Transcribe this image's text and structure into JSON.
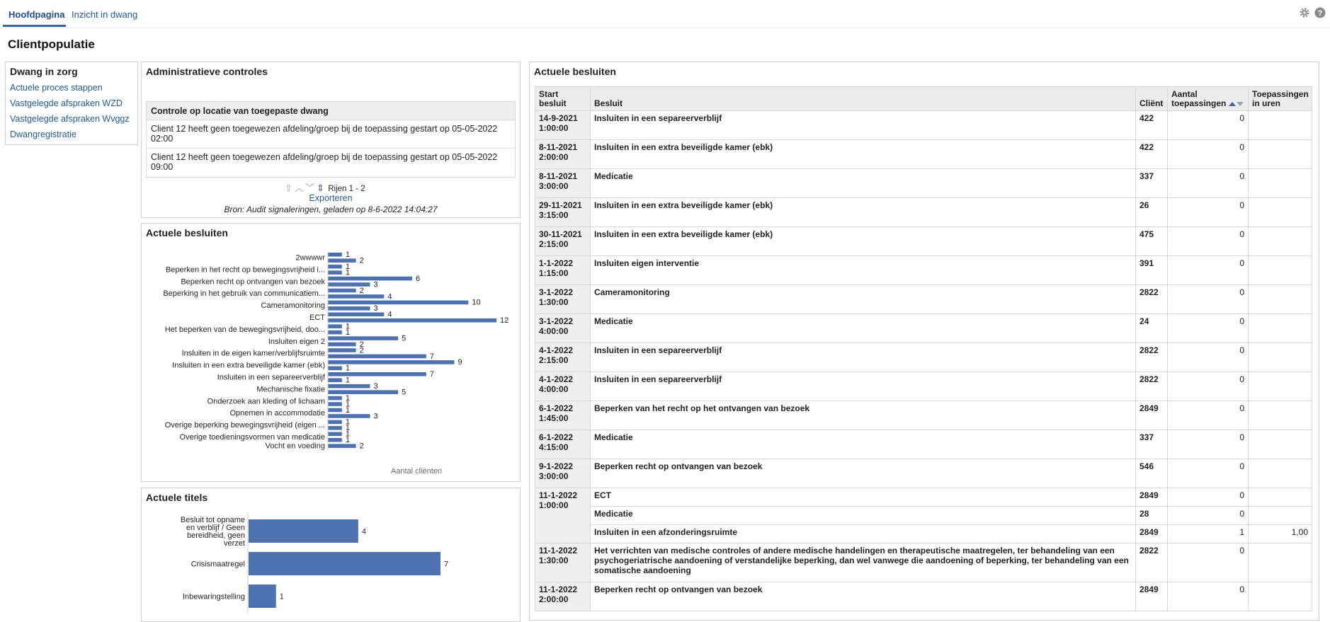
{
  "tabs": [
    {
      "label": "Hoofdpagina",
      "active": true
    },
    {
      "label": "Inzicht in dwang",
      "active": false
    }
  ],
  "top_icons": [
    "gear-icon",
    "help-icon"
  ],
  "page_title": "Clientpopulatie",
  "menu": {
    "title": "Dwang in zorg",
    "links": [
      "Actuele proces stappen",
      "Vastgelegde afspraken WZD",
      "Vastgelegde afspraken Wvggz",
      "Dwangregistratie"
    ]
  },
  "admin": {
    "title": "Administratieve controles",
    "table_header": "Controle op locatie van toegepaste dwang",
    "rows": [
      "Client 12 heeft geen toegewezen afdeling/groep bij de toepassing gestart op 05-05-2022 02:00",
      "Client 12 heeft geen toegewezen afdeling/groep bij de toepassing gestart op 05-05-2022 09:00"
    ],
    "pager_text": "Rijen 1 - 2",
    "export_label": "Exporteren",
    "source": "Bron: Audit signaleringen, geladen op 8-6-2022 14:04:27"
  },
  "chart_data": [
    {
      "type": "bar",
      "orientation": "horizontal",
      "title": "Actuele besluiten",
      "xlabel": "Aantal cliënten",
      "bar_color": "#4e72b0",
      "categories": [
        "2wwwwr",
        "Beperken in het recht op bewegingsvrijheid i...",
        "Beperken recht op ontvangen van bezoek",
        "Beperking in het gebruik van communicatiem...",
        "Cameramonitoring",
        "ECT",
        "Het beperken van de bewegingsvrijheid, doo...",
        "Insluiten eigen 2",
        "Insluiten in de eigen kamer/verblijfsruimte",
        "Insluiten in een extra beveiligde kamer (ebk)",
        "Insluiten in een separeerverblijf",
        "Mechanische fixatie",
        "Onderzoek aan kleding of lichaam",
        "Opnemen in accommodatie",
        "Overige beperking bewegingsvrijheid (eigen ...",
        "Overige toedieningsvormen van medicatie",
        "Vocht en voeding"
      ],
      "bars": [
        {
          "category": 0,
          "value": 1
        },
        {
          "category": 0,
          "value": 2
        },
        {
          "category": 1,
          "value": 1
        },
        {
          "category": 1,
          "value": 1
        },
        {
          "category": 2,
          "value": 6
        },
        {
          "category": 2,
          "value": 3
        },
        {
          "category": 3,
          "value": 2
        },
        {
          "category": 3,
          "value": 4
        },
        {
          "category": 4,
          "value": 10
        },
        {
          "category": 4,
          "value": 3
        },
        {
          "category": 5,
          "value": 4
        },
        {
          "category": 5,
          "value": 12
        },
        {
          "category": 6,
          "value": 1
        },
        {
          "category": 6,
          "value": 1
        },
        {
          "category": 7,
          "value": 5
        },
        {
          "category": 7,
          "value": 2
        },
        {
          "category": 8,
          "value": 2
        },
        {
          "category": 8,
          "value": 7
        },
        {
          "category": 9,
          "value": 9
        },
        {
          "category": 9,
          "value": 1
        },
        {
          "category": 10,
          "value": 7
        },
        {
          "category": 10,
          "value": 1
        },
        {
          "category": 11,
          "value": 3
        },
        {
          "category": 11,
          "value": 5
        },
        {
          "category": 12,
          "value": 1
        },
        {
          "category": 12,
          "value": 1
        },
        {
          "category": 13,
          "value": 1
        },
        {
          "category": 13,
          "value": 3
        },
        {
          "category": 14,
          "value": 1
        },
        {
          "category": 14,
          "value": 1
        },
        {
          "category": 15,
          "value": 1
        },
        {
          "category": 15,
          "value": 1
        },
        {
          "category": 16,
          "value": 2
        }
      ],
      "xlim": [
        0,
        12
      ]
    },
    {
      "type": "bar",
      "orientation": "horizontal",
      "title": "Actuele titels",
      "bar_color": "#4e72b0",
      "categories": [
        "Besluit tot opname en verblijf / Geen bereidheid, geen verzet",
        "Crisismaatregel",
        "Inbewaringstelling"
      ],
      "values": [
        4,
        7,
        1
      ],
      "xlim": [
        0,
        7
      ]
    }
  ],
  "besluiten": {
    "title": "Actuele besluiten",
    "columns": [
      "Start besluit",
      "Besluit",
      "Cliënt",
      "Aantal toepassingen",
      "Toepassingen in uren"
    ],
    "groups": [
      {
        "start": "14-9-2021 1:00:00",
        "items": [
          {
            "besluit": "Insluiten in een separeerverblijf",
            "client": "422",
            "aantal": "0",
            "uren": ""
          }
        ]
      },
      {
        "start": "8-11-2021 2:00:00",
        "items": [
          {
            "besluit": "Insluiten in een extra beveiligde kamer (ebk)",
            "client": "422",
            "aantal": "0",
            "uren": ""
          }
        ]
      },
      {
        "start": "8-11-2021 3:00:00",
        "items": [
          {
            "besluit": "Medicatie",
            "client": "337",
            "aantal": "0",
            "uren": ""
          }
        ]
      },
      {
        "start": "29-11-2021 3:15:00",
        "items": [
          {
            "besluit": "Insluiten in een extra beveiligde kamer (ebk)",
            "client": "26",
            "aantal": "0",
            "uren": ""
          }
        ]
      },
      {
        "start": "30-11-2021 2:15:00",
        "items": [
          {
            "besluit": "Insluiten in een extra beveiligde kamer (ebk)",
            "client": "475",
            "aantal": "0",
            "uren": ""
          }
        ]
      },
      {
        "start": "1-1-2022 1:15:00",
        "items": [
          {
            "besluit": "Insluiten eigen interventie",
            "client": "391",
            "aantal": "0",
            "uren": ""
          }
        ]
      },
      {
        "start": "3-1-2022 1:30:00",
        "items": [
          {
            "besluit": "Cameramonitoring",
            "client": "2822",
            "aantal": "0",
            "uren": ""
          }
        ]
      },
      {
        "start": "3-1-2022 4:00:00",
        "items": [
          {
            "besluit": "Medicatie",
            "client": "24",
            "aantal": "0",
            "uren": ""
          }
        ]
      },
      {
        "start": "4-1-2022 2:15:00",
        "items": [
          {
            "besluit": "Insluiten in een separeerverblijf",
            "client": "2822",
            "aantal": "0",
            "uren": ""
          }
        ]
      },
      {
        "start": "4-1-2022 4:00:00",
        "items": [
          {
            "besluit": "Insluiten in een separeerverblijf",
            "client": "2822",
            "aantal": "0",
            "uren": ""
          }
        ]
      },
      {
        "start": "6-1-2022 1:45:00",
        "items": [
          {
            "besluit": "Beperken van het recht op het ontvangen van bezoek",
            "client": "2849",
            "aantal": "0",
            "uren": ""
          }
        ]
      },
      {
        "start": "6-1-2022 4:15:00",
        "items": [
          {
            "besluit": "Medicatie",
            "client": "337",
            "aantal": "0",
            "uren": ""
          }
        ]
      },
      {
        "start": "9-1-2022 3:00:00",
        "items": [
          {
            "besluit": "Beperken recht op ontvangen van bezoek",
            "client": "546",
            "aantal": "0",
            "uren": ""
          }
        ]
      },
      {
        "start": "11-1-2022 1:00:00",
        "items": [
          {
            "besluit": "ECT",
            "client": "2849",
            "aantal": "0",
            "uren": ""
          },
          {
            "besluit": "Medicatie",
            "client": "28",
            "aantal": "0",
            "uren": ""
          },
          {
            "besluit": "Insluiten in een afzonderingsruimte",
            "client": "2849",
            "aantal": "1",
            "uren": "1,00"
          }
        ]
      },
      {
        "start": "11-1-2022 1:30:00",
        "items": [
          {
            "besluit": "Het verrichten van medische controles of andere medische handelingen en therapeutische maatregelen, ter behandeling van een psychogeriatrische aandoening of verstandelijke beperking, dan wel vanwege die aandoening of beperking, ter behandeling van een somatische aandoening",
            "client": "2822",
            "aantal": "0",
            "uren": ""
          }
        ]
      },
      {
        "start": "11-1-2022 2:00:00",
        "items": [
          {
            "besluit": "Beperken recht op ontvangen van bezoek",
            "client": "2849",
            "aantal": "0",
            "uren": ""
          }
        ]
      }
    ]
  }
}
